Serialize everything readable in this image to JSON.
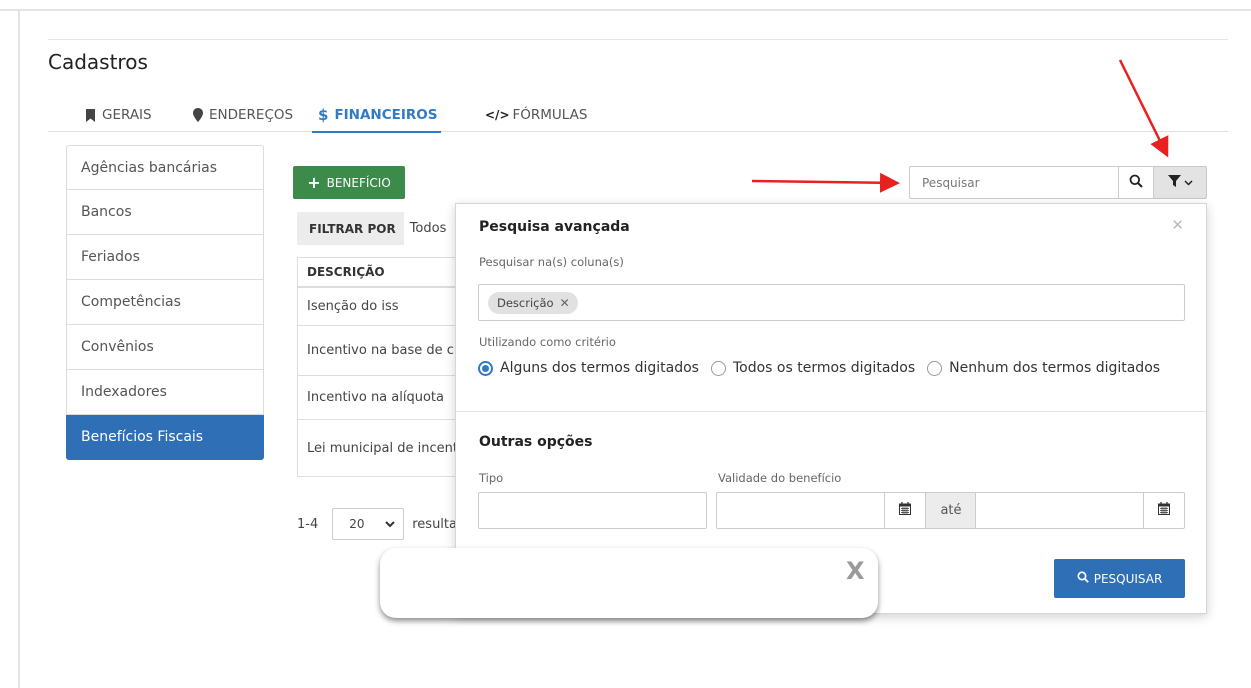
{
  "page": {
    "title": "Cadastros"
  },
  "tabs": [
    {
      "label": "GERAIS",
      "icon": "bookmark-icon"
    },
    {
      "label": "ENDEREÇOS",
      "icon": "map-pin-icon"
    },
    {
      "label": "FINANCEIROS",
      "icon": "dollar-icon",
      "active": true
    },
    {
      "label": "FÓRMULAS",
      "icon": "code-icon"
    }
  ],
  "sidebar": {
    "items": [
      {
        "label": "Agências bancárias"
      },
      {
        "label": "Bancos"
      },
      {
        "label": "Feriados"
      },
      {
        "label": "Competências"
      },
      {
        "label": "Convênios"
      },
      {
        "label": "Indexadores"
      },
      {
        "label": "Benefícios Fiscais",
        "active": true
      }
    ]
  },
  "toolbar": {
    "new_button_label": "BENEFÍCIO",
    "new_button_icon": "plus-icon",
    "search_placeholder": "Pesquisar",
    "search_icon": "search-icon",
    "filter_icon": "filter-icon"
  },
  "filter": {
    "label": "FILTRAR POR",
    "value": "Todos"
  },
  "table": {
    "header": "DESCRIÇÃO",
    "rows": [
      "Isenção do iss",
      "Incentivo na base de c",
      "Incentivo na alíquota",
      "Lei municipal de incent"
    ]
  },
  "pagination": {
    "range": "1-4",
    "page_size": "20",
    "suffix": "resulta"
  },
  "advanced_search": {
    "title": "Pesquisa avançada",
    "close_icon": "close-icon",
    "columns_label": "Pesquisar na(s) coluna(s)",
    "selected_columns": [
      "Descrição"
    ],
    "criteria_label": "Utilizando como critério",
    "criteria_options": [
      {
        "label": "Alguns dos termos digitados",
        "checked": true
      },
      {
        "label": "Todos os termos digitados",
        "checked": false
      },
      {
        "label": "Nenhum dos termos digitados",
        "checked": false
      }
    ],
    "other_options_title": "Outras opções",
    "type_label": "Tipo",
    "type_value": "",
    "validity_label": "Validade do benefício",
    "date_from": "",
    "date_to": "",
    "until_label": "até",
    "search_button_label": "PESQUISAR"
  },
  "overlay": {
    "close_label": "X"
  },
  "colors": {
    "accent": "#2f7bc4",
    "primary_button": "#2f6fb5",
    "success_button": "#3c8b4a",
    "annotation_arrow": "#e8201f"
  }
}
